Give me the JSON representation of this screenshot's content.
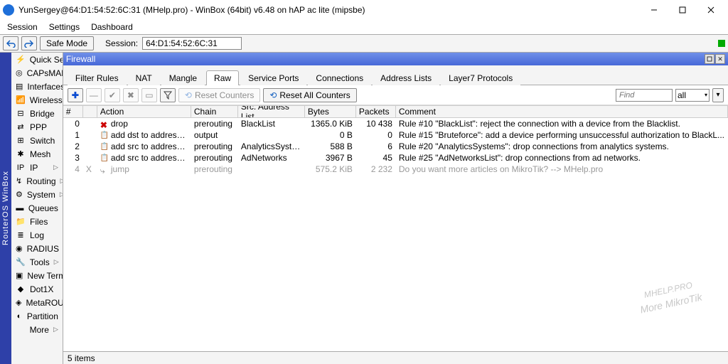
{
  "title": "YunSergey@64:D1:54:52:6C:31 (MHelp.pro) - WinBox (64bit) v6.48 on hAP ac lite (mipsbe)",
  "menu": [
    "Session",
    "Settings",
    "Dashboard"
  ],
  "safe_mode": "Safe Mode",
  "session_label": "Session:",
  "session_value": "64:D1:54:52:6C:31",
  "brand": "RouterOS WinBox",
  "sidebar": [
    {
      "icon": "⚡",
      "label": "Quick Set",
      "chev": false
    },
    {
      "icon": "◎",
      "label": "CAPsMAN",
      "chev": false
    },
    {
      "icon": "▤",
      "label": "Interfaces",
      "chev": false
    },
    {
      "icon": "📶",
      "label": "Wireless",
      "chev": false
    },
    {
      "icon": "⊟",
      "label": "Bridge",
      "chev": false
    },
    {
      "icon": "⇄",
      "label": "PPP",
      "chev": false
    },
    {
      "icon": "⊞",
      "label": "Switch",
      "chev": false
    },
    {
      "icon": "✱",
      "label": "Mesh",
      "chev": false
    },
    {
      "icon": "IP",
      "label": "IP",
      "chev": true
    },
    {
      "icon": "↯",
      "label": "Routing",
      "chev": true
    },
    {
      "icon": "⚙",
      "label": "System",
      "chev": true
    },
    {
      "icon": "▬",
      "label": "Queues",
      "chev": false
    },
    {
      "icon": "📁",
      "label": "Files",
      "chev": false
    },
    {
      "icon": "≣",
      "label": "Log",
      "chev": false
    },
    {
      "icon": "◉",
      "label": "RADIUS",
      "chev": false
    },
    {
      "icon": "🔧",
      "label": "Tools",
      "chev": true
    },
    {
      "icon": "▣",
      "label": "New Terminal",
      "chev": false
    },
    {
      "icon": "◆",
      "label": "Dot1X",
      "chev": false
    },
    {
      "icon": "◈",
      "label": "MetaROUTER",
      "chev": false
    },
    {
      "icon": "◐",
      "label": "Partition",
      "chev": false
    },
    {
      "icon": "",
      "label": "More",
      "chev": true
    }
  ],
  "panel_title": "Firewall",
  "tabs": [
    "Filter Rules",
    "NAT",
    "Mangle",
    "Raw",
    "Service Ports",
    "Connections",
    "Address Lists",
    "Layer7 Protocols"
  ],
  "active_tab": 3,
  "reset_counters": "Reset Counters",
  "reset_all_counters": "Reset All Counters",
  "find_placeholder": "Find",
  "filter_sel": "all",
  "columns": [
    "#",
    "",
    "Action",
    "Chain",
    "Src. Address List",
    "Bytes",
    "Packets",
    "Comment"
  ],
  "rows": [
    {
      "n": "0",
      "flag": "",
      "icon": "drop",
      "action": "drop",
      "chain": "prerouting",
      "src": "BlackList",
      "bytes": "1365.0 KiB",
      "packets": "10 438",
      "comment": "Rule #10 \"BlackList\": reject the connection with a device from the Blacklist.",
      "disabled": false
    },
    {
      "n": "1",
      "flag": "",
      "icon": "list",
      "action": "add dst to address list",
      "chain": "output",
      "src": "",
      "bytes": "0 B",
      "packets": "0",
      "comment": "Rule #15 \"Bruteforce\": add a device performing unsuccessful authorization to BlackL...",
      "disabled": false
    },
    {
      "n": "2",
      "flag": "",
      "icon": "list",
      "action": "add src to address list",
      "chain": "prerouting",
      "src": "AnalyticsSystems",
      "bytes": "588 B",
      "packets": "6",
      "comment": "Rule #20 \"AnalyticsSystems\": drop connections from analytics systems.",
      "disabled": false
    },
    {
      "n": "3",
      "flag": "",
      "icon": "list",
      "action": "add src to address list",
      "chain": "prerouting",
      "src": "AdNetworks",
      "bytes": "3967 B",
      "packets": "45",
      "comment": "Rule #25 \"AdNetworksList\": drop connections from ad networks.",
      "disabled": false
    },
    {
      "n": "4",
      "flag": "X",
      "icon": "jump",
      "action": "jump",
      "chain": "prerouting",
      "src": "",
      "bytes": "575.2 KiB",
      "packets": "2 232",
      "comment": "Do you want more articles on MikroTik? --> MHelp.pro",
      "disabled": true
    }
  ],
  "status": "5 items",
  "watermark_main": "MHELP.PRO",
  "watermark_sub": "More MikroTik"
}
